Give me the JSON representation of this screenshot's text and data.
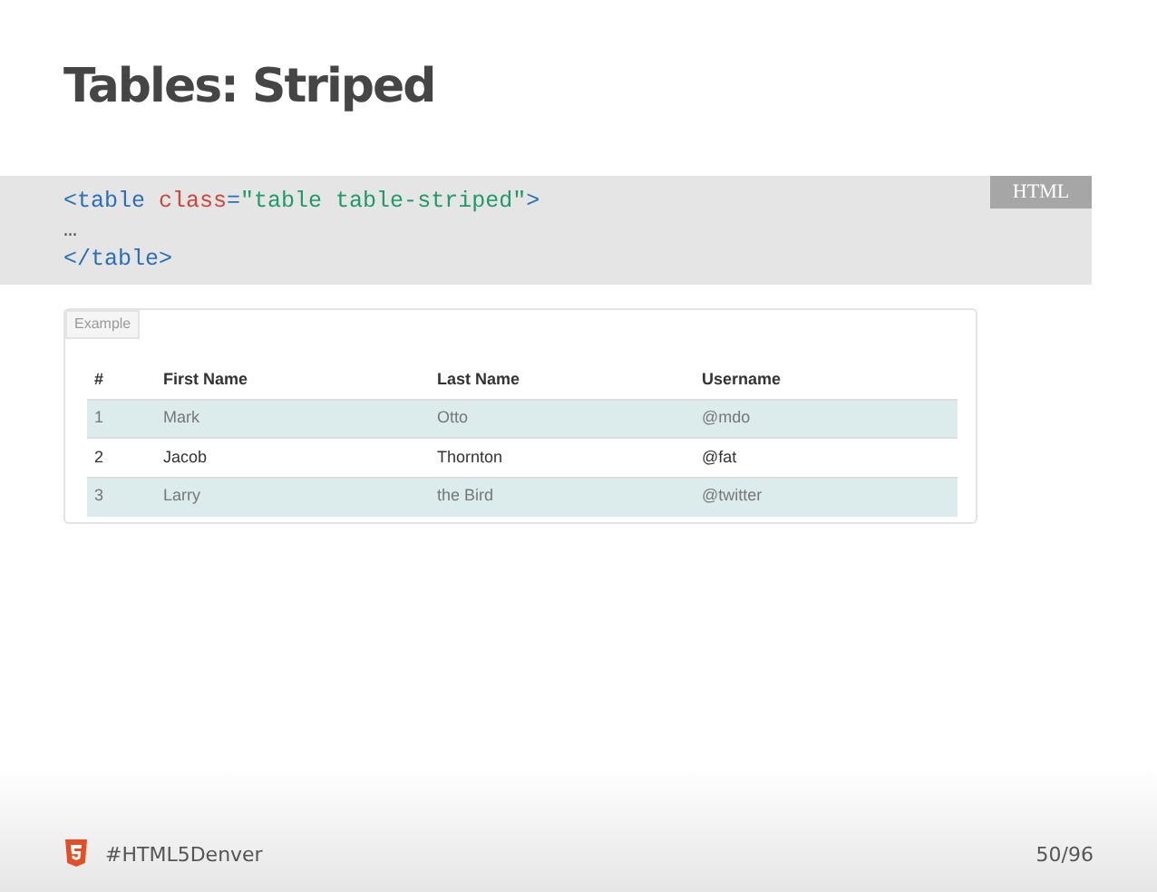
{
  "title": "Tables: Striped",
  "code": {
    "language": "HTML",
    "lines": [
      [
        {
          "kind": "tag",
          "text": "<table "
        },
        {
          "kind": "attr",
          "text": "class"
        },
        {
          "kind": "tag",
          "text": "="
        },
        {
          "kind": "string",
          "text": "\"table table-striped\""
        },
        {
          "kind": "tag",
          "text": ">"
        }
      ],
      [
        {
          "kind": "plain",
          "text": "…"
        }
      ],
      [
        {
          "kind": "tag",
          "text": "</table>"
        }
      ]
    ]
  },
  "example": {
    "label": "Example",
    "table": {
      "columns": [
        "#",
        "First Name",
        "Last Name",
        "Username"
      ],
      "rows": [
        {
          "striped": true,
          "cells": [
            "1",
            "Mark",
            "Otto",
            "@mdo"
          ]
        },
        {
          "striped": false,
          "cells": [
            "2",
            "Jacob",
            "Thornton",
            "@fat"
          ]
        },
        {
          "striped": true,
          "cells": [
            "3",
            "Larry",
            "the Bird",
            "@twitter"
          ]
        }
      ]
    }
  },
  "footer": {
    "hashtag": "#HTML5Denver",
    "page": "50/96"
  }
}
